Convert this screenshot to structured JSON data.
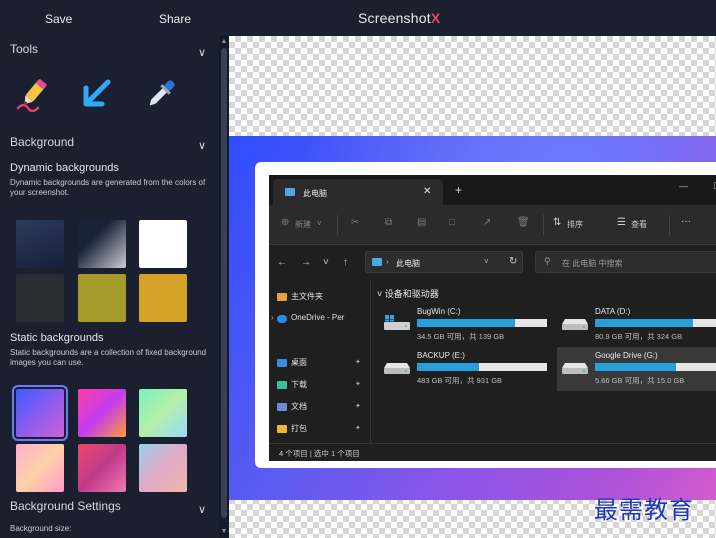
{
  "header": {
    "save_label": "Save",
    "share_label": "Share",
    "title_main": "Screenshot",
    "title_mark": "X"
  },
  "sidebar": {
    "tools_title": "Tools",
    "background_title": "Background",
    "dynamic": {
      "title": "Dynamic backgrounds",
      "desc": "Dynamic backgrounds are generated from the colors of your screenshot."
    },
    "static": {
      "title": "Static backgrounds",
      "desc": "Static backgrounds are a collection of fixed background images you can use."
    },
    "settings_title": "Background Settings",
    "bg_size_label": "Background size:"
  },
  "explorer": {
    "tab_title": "此电脑",
    "toolbar": {
      "new": "新建",
      "sort": "排序",
      "view": "查看",
      "more": "···"
    },
    "address": "此电脑",
    "search_placeholder": "在 此电脑 中搜索",
    "nav": {
      "home": "主文件夹",
      "onedrive": "OneDrive - Per",
      "desktop": "桌面",
      "downloads": "下载",
      "documents": "文档",
      "packing": "打包"
    },
    "group_title": "设备和驱动器",
    "drives": [
      {
        "name": "BugWin (C:)",
        "capacity": "34.5 GB 可用，共 139 GB",
        "used_fraction": 0.75
      },
      {
        "name": "DATA (D:)",
        "capacity": "80.9 GB 可用，共 324 GB",
        "used_fraction": 0.75
      },
      {
        "name": "BACKUP (E:)",
        "capacity": "483 GB 可用，共 931 GB",
        "used_fraction": 0.48
      },
      {
        "name": "Google Drive (G:)",
        "capacity": "5.66 GB 可用，共 15.0 GB",
        "used_fraction": 0.62
      }
    ],
    "status": "4 个项目  |  选中 1 个项目"
  },
  "watermark": "最需教育"
}
